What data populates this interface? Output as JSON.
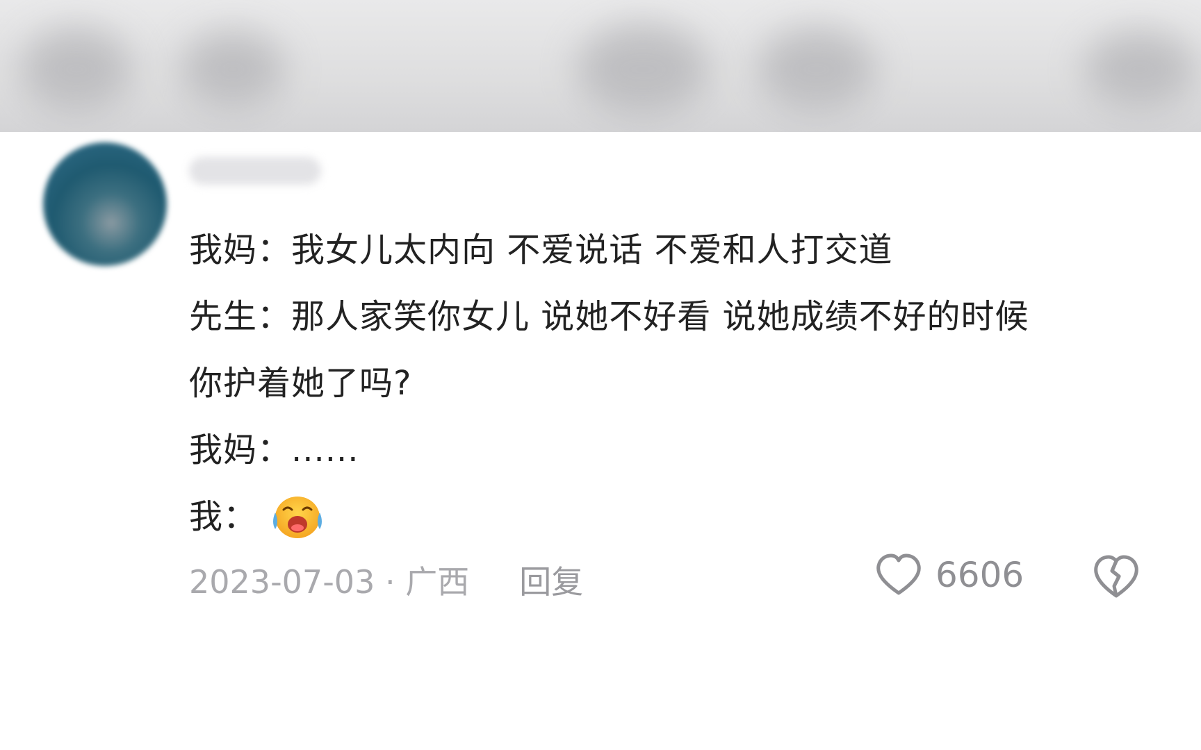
{
  "comment": {
    "lines": [
      "我妈：我女儿太内向 不爱说话 不爱和人打交道",
      "先生：那人家笑你女儿 说她不好看 说她成绩不好的时候",
      "你护着她了吗?",
      "我妈：......"
    ],
    "last_line_prefix": "我：",
    "emoji": "crying-face-emoji"
  },
  "meta": {
    "date_location": "2023-07-03 · 广西",
    "reply_label": "回复",
    "like_count": "6606"
  },
  "icons": {
    "like": "heart-outline-icon",
    "dislike": "broken-heart-icon"
  }
}
